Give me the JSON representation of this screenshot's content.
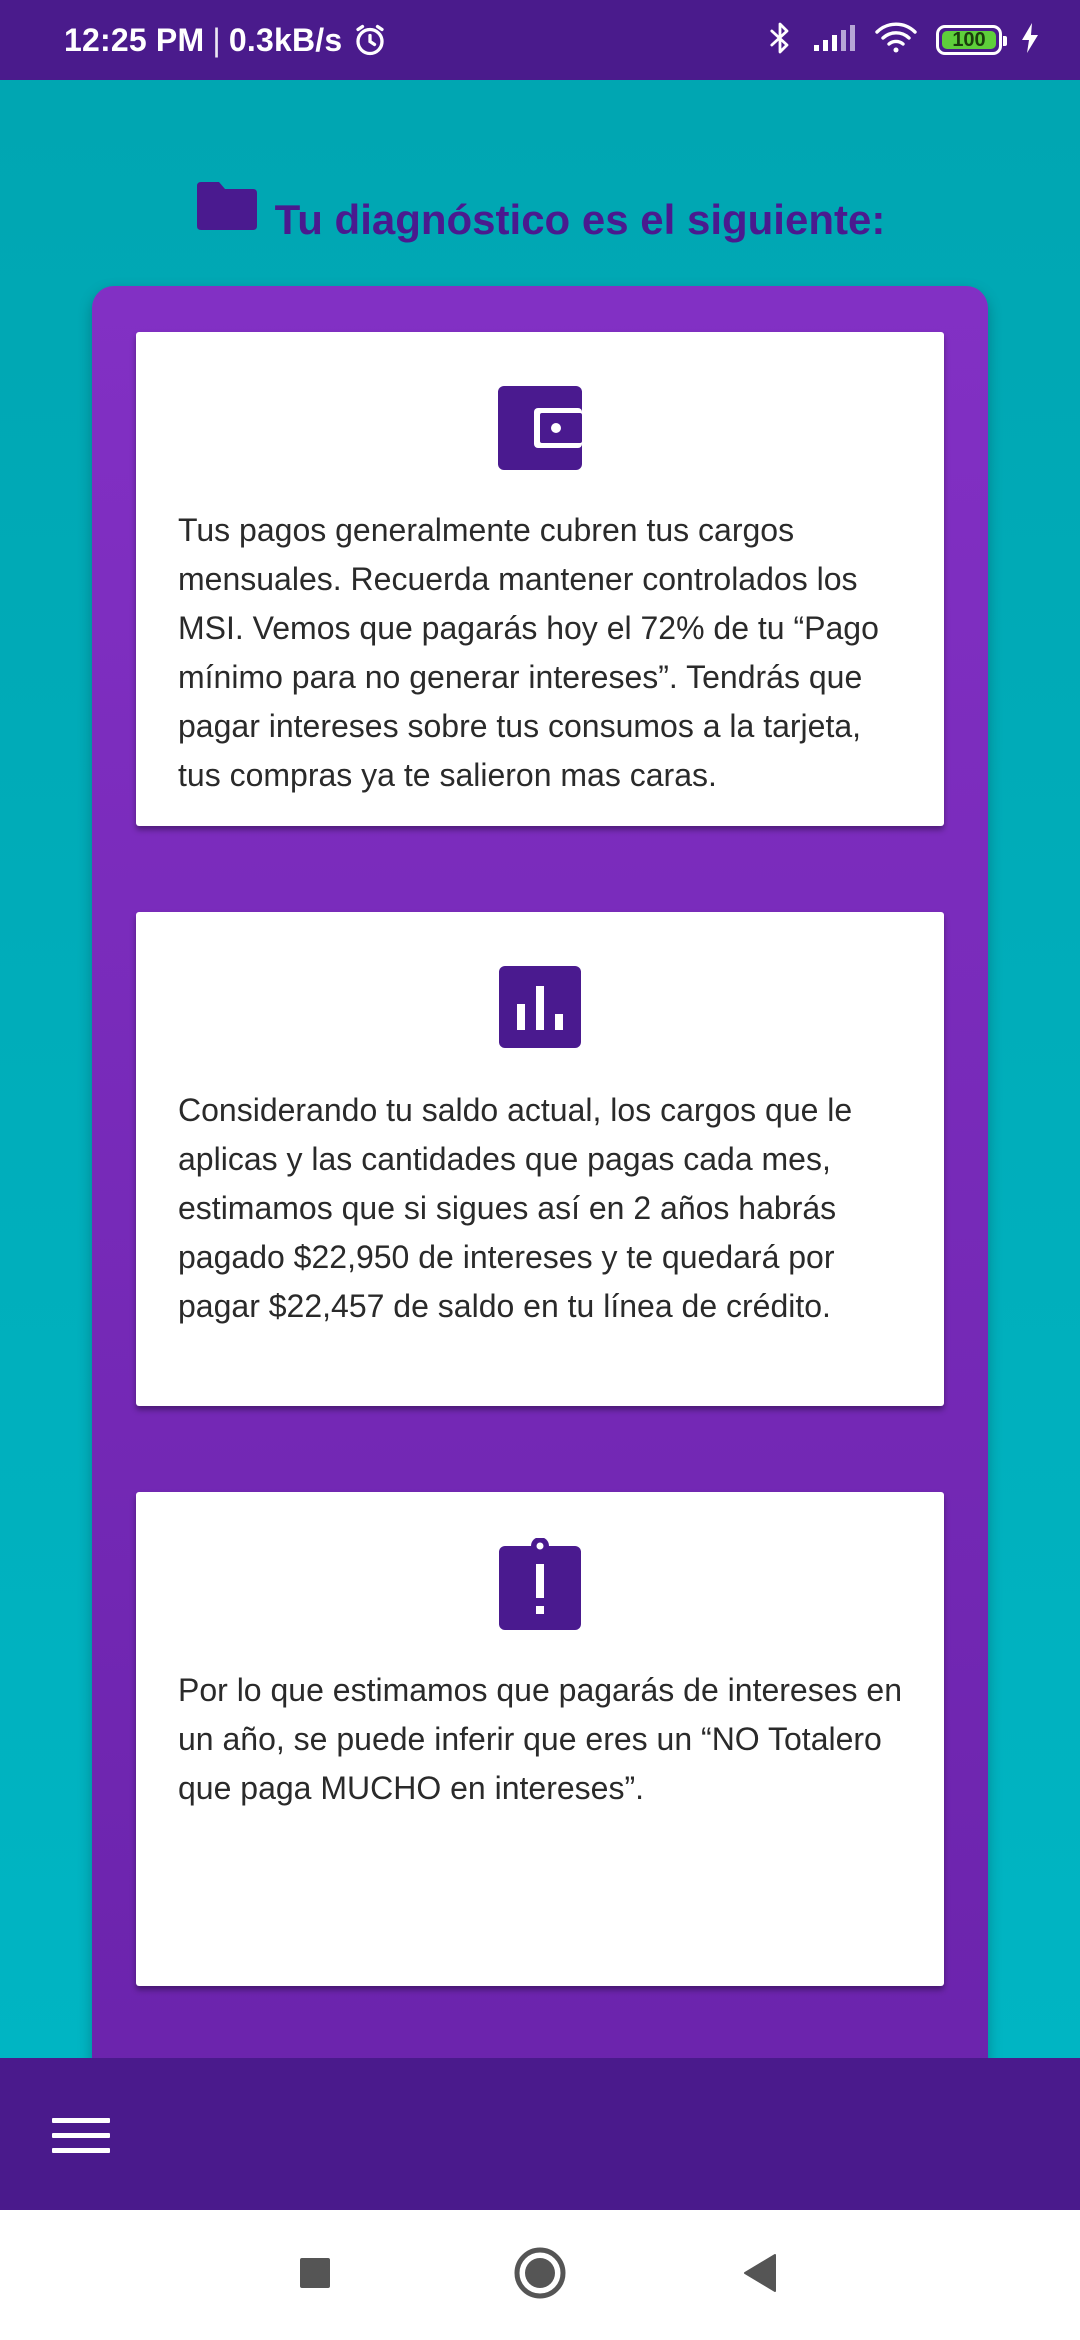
{
  "status_bar": {
    "time": "12:25 PM",
    "separator": "|",
    "net_speed": "0.3kB/s",
    "battery_level": "100"
  },
  "heading": {
    "title": "Tu diagnóstico es el siguiente:",
    "icon": "folder-icon"
  },
  "cards": [
    {
      "icon": "wallet-icon",
      "text": "Tus pagos generalmente cubren tus cargos mensuales. Recuerda mantener controlados los MSI. Vemos que pagarás hoy el 72% de tu “Pago mínimo para no generar intereses”. Tendrás que pagar intereses sobre tus consumos a la tarjeta, tus compras ya te salieron mas caras."
    },
    {
      "icon": "bar-chart-icon",
      "text": "Considerando tu saldo actual, los cargos que le aplicas y las cantidades que pagas cada mes, estimamos que si sigues así en 2 años habrás pagado $22,950 de intereses y te quedará por pagar $22,457 de saldo en tu línea de crédito."
    },
    {
      "icon": "clipboard-alert-icon",
      "text": "Por lo que estimamos que pagarás de intereses en un año, se puede inferir que eres un “NO Totalero que paga MUCHO en intereses”."
    }
  ],
  "app_bar": {
    "menu_icon": "hamburger-menu-icon"
  },
  "nav_bar": {
    "buttons": [
      "recents-square-icon",
      "home-circle-icon",
      "back-triangle-icon"
    ]
  },
  "colors": {
    "status_bar": "#4a1b8c",
    "background_teal": "#00b3c0",
    "panel_purple": "#7a2bbd",
    "accent_purple": "#4a1a8f",
    "card_white": "#ffffff"
  }
}
